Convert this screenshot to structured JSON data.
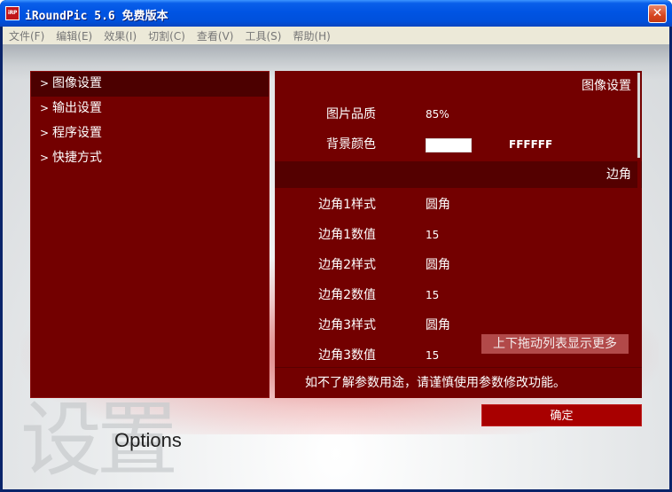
{
  "window": {
    "icon_text": "iRP",
    "title": "iRoundPic 5.6 免费版本",
    "close_glyph": "✕"
  },
  "menu": [
    {
      "label": "文件(F)"
    },
    {
      "label": "编辑(E)"
    },
    {
      "label": "效果(I)"
    },
    {
      "label": "切割(C)"
    },
    {
      "label": "查看(V)"
    },
    {
      "label": "工具(S)"
    },
    {
      "label": "帮助(H)"
    }
  ],
  "nav": {
    "arrow": ">",
    "items": [
      {
        "label": "图像设置",
        "active": true
      },
      {
        "label": "输出设置",
        "active": false
      },
      {
        "label": "程序设置",
        "active": false
      },
      {
        "label": "快捷方式",
        "active": false
      }
    ]
  },
  "settings": {
    "section_image": "图像设置",
    "quality_label": "图片品质",
    "quality_value": "85%",
    "bgcolor_label": "背景颜色",
    "bgcolor_swatch": "#FFFFFF",
    "bgcolor_value": "FFFFFF",
    "section_corner": "边角",
    "corner_rows": [
      {
        "label": "边角1样式",
        "value": "圆角"
      },
      {
        "label": "边角1数值",
        "value": "15"
      },
      {
        "label": "边角2样式",
        "value": "圆角"
      },
      {
        "label": "边角2数值",
        "value": "15"
      },
      {
        "label": "边角3样式",
        "value": "圆角"
      },
      {
        "label": "边角3数值",
        "value": "15"
      }
    ],
    "more_hint": "上下拖动列表显示更多",
    "warning": "如不了解参数用途，请谨慎使用参数修改功能。"
  },
  "ok_button": "确定",
  "background": {
    "watermark": "设置",
    "options_label": "Options"
  },
  "colors": {
    "panel_red": "#730000",
    "active_red": "#4c0000",
    "button_red": "#a80000",
    "titlebar_blue": "#0054e3"
  }
}
